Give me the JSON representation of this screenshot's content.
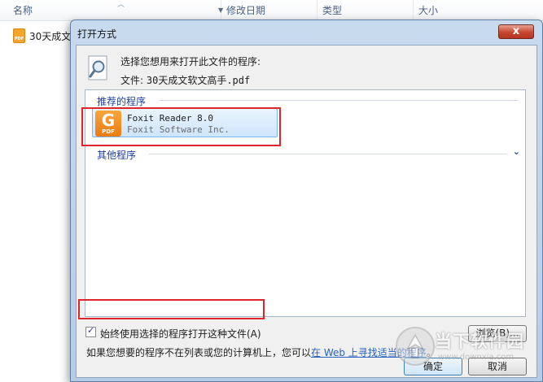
{
  "explorer": {
    "columns": {
      "name": "名称",
      "date_modified": "修改日期",
      "type": "类型",
      "size": "大小"
    },
    "file": {
      "name": "30天成文"
    }
  },
  "dialog": {
    "title": "打开方式",
    "close_glyph": "x",
    "prompt": "选择您想用来打开此文件的程序:",
    "file_label": "文件:",
    "file_name": "30天成文软文高手.pdf",
    "recommended_header": "推荐的程序",
    "other_header": "其他程序",
    "program": {
      "name": "Foxit Reader 8.0",
      "company": "Foxit Software Inc.",
      "icon_badge": "PDF",
      "icon": "foxit-reader-icon"
    },
    "always_use_label": "始终使用选择的程序打开这种文件(A)",
    "always_use_checked": true,
    "browse_label": "浏览(B)...",
    "hint_prefix": "如果您想要的程序不在列表或您的计算机上，您可以",
    "hint_link": "在 Web 上寻找适当的程序",
    "hint_suffix": "。",
    "ok_label": "确定",
    "cancel_label": "取消"
  },
  "watermark": {
    "text": "当下软件园",
    "url": "www.downxia.com"
  },
  "colors": {
    "dialog_frame": "#c8daee",
    "link": "#2761c0",
    "highlight_box": "#e0242b",
    "selection": "#cfe5fb",
    "foxit_orange": "#ec7b13"
  }
}
